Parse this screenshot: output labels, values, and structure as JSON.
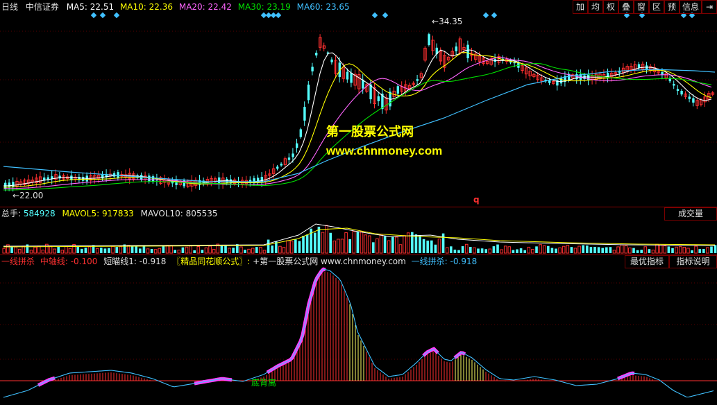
{
  "price": {
    "period": "日线",
    "name": "中信证券",
    "ma5_label": "MA5:",
    "ma5": "22.51",
    "ma10_label": "MA10:",
    "ma10": "22.36",
    "ma20_label": "MA20:",
    "ma20": "22.42",
    "ma30_label": "MA30:",
    "ma30": "23.19",
    "ma60_label": "MA60:",
    "ma60": "23.65",
    "high_marker": "34.35",
    "low_marker": "22.00",
    "q_marker": "q"
  },
  "toolbar": {
    "items": [
      "加",
      "均",
      "权",
      "叠",
      "窗",
      "区",
      "预",
      "信息"
    ],
    "exit_glyph": "⇥"
  },
  "watermark": {
    "line1": "第一股票公式网",
    "line2": "www.chnmoney.com"
  },
  "volume": {
    "label": "总手:",
    "value": "584928",
    "mavol5_label": "MAVOL5:",
    "mavol5": "917833",
    "mavol10_label": "MAVOL10:",
    "mavol10": "805535",
    "button": "成交量"
  },
  "indicator": {
    "t1": "一线拼杀",
    "t2": "中轴线:",
    "v2": "-0.100",
    "t3": "短瞄线1:",
    "v3": "-0.918",
    "t4": "〖精品同花顺公式〗:",
    "t5": "+第一股票公式网 www.chnmoney.com",
    "t6": "一线拼杀:",
    "v6": "-0.918",
    "btn_best": "最优指标",
    "btn_help": "指标说明",
    "annotation": "底背离"
  },
  "colors": {
    "ma5": "#ffffff",
    "ma10": "#ffff00",
    "ma20": "#ff66ff",
    "ma30": "#00e000",
    "ma60": "#40c0ff",
    "up": "#ff3030",
    "down": "#54ffff",
    "divider": "#8b0000"
  }
}
